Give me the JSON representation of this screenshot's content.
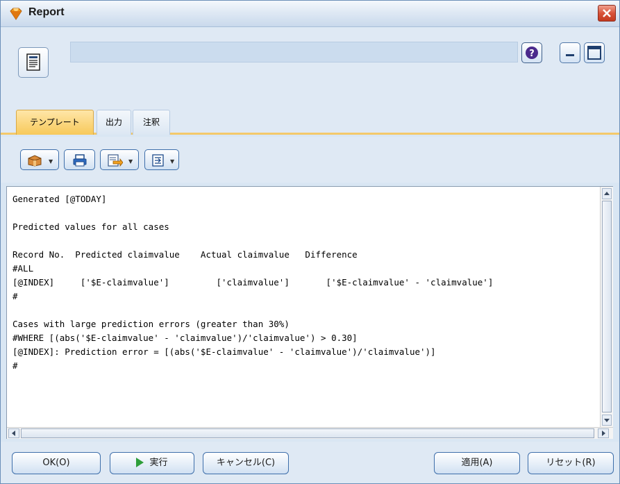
{
  "window": {
    "title": "Report",
    "icon": "diamond-app-icon"
  },
  "header": {
    "node_icon": "report-document-icon",
    "name_value": "",
    "help_icon": "help-icon",
    "minimize_icon": "minimize-icon",
    "maximize_icon": "maximize-icon",
    "close_icon": "close-icon"
  },
  "tabs": [
    {
      "label": "テンプレート",
      "active": true
    },
    {
      "label": "出力",
      "active": false
    },
    {
      "label": "注釈",
      "active": false
    }
  ],
  "toolbar": {
    "buttons": [
      {
        "icon": "package-icon",
        "dropdown": true
      },
      {
        "icon": "print-icon",
        "dropdown": false
      },
      {
        "icon": "export-icon",
        "dropdown": true
      },
      {
        "icon": "insert-field-icon",
        "dropdown": true
      }
    ]
  },
  "editor": {
    "lines": [
      "Generated [@TODAY]",
      "",
      "Predicted values for all cases",
      "",
      "Record No.  Predicted claimvalue    Actual claimvalue   Difference",
      "#ALL",
      "[@INDEX]     ['$E-claimvalue']         ['claimvalue']       ['$E-claimvalue' - 'claimvalue']",
      "#",
      "",
      "Cases with large prediction errors (greater than 30%)",
      "#WHERE [(abs('$E-claimvalue' - 'claimvalue')/'claimvalue') > 0.30]",
      "[@INDEX]: Prediction error = [(abs('$E-claimvalue' - 'claimvalue')/'claimvalue')]",
      "#"
    ]
  },
  "buttons": {
    "ok": "OK(O)",
    "run": "実行",
    "cancel": "キャンセル(C)",
    "apply": "適用(A)",
    "reset": "リセット(R)"
  },
  "colors": {
    "active_tab": "#f7c95a",
    "run_icon": "#2e9e3a",
    "close_button": "#d9533a",
    "button_border": "#3d6eaa"
  }
}
